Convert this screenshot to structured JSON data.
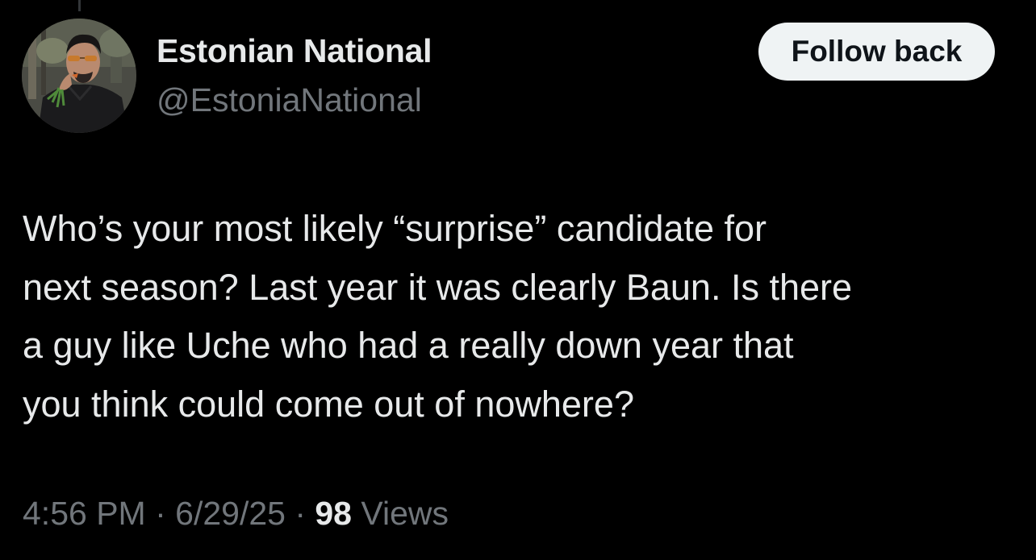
{
  "author": {
    "display_name": "Estonian National",
    "handle": "@EstoniaNational"
  },
  "actions": {
    "follow_label": "Follow back"
  },
  "tweet": {
    "lines": [
      "Who’s your most likely “surprise” candidate for",
      "next season? Last year it was clearly Baun. Is there",
      "a guy like Uche who had a really down year that",
      "you think could come out of nowhere?"
    ]
  },
  "meta": {
    "time": "4:56 PM",
    "separator": " · ",
    "date": "6/29/25",
    "views_count": "98",
    "views_label": " Views"
  },
  "colors": {
    "background": "#000000",
    "primary_text": "#e7e9ea",
    "secondary_text": "#71767b",
    "button_bg": "#eff3f4",
    "button_text": "#0f1419"
  }
}
